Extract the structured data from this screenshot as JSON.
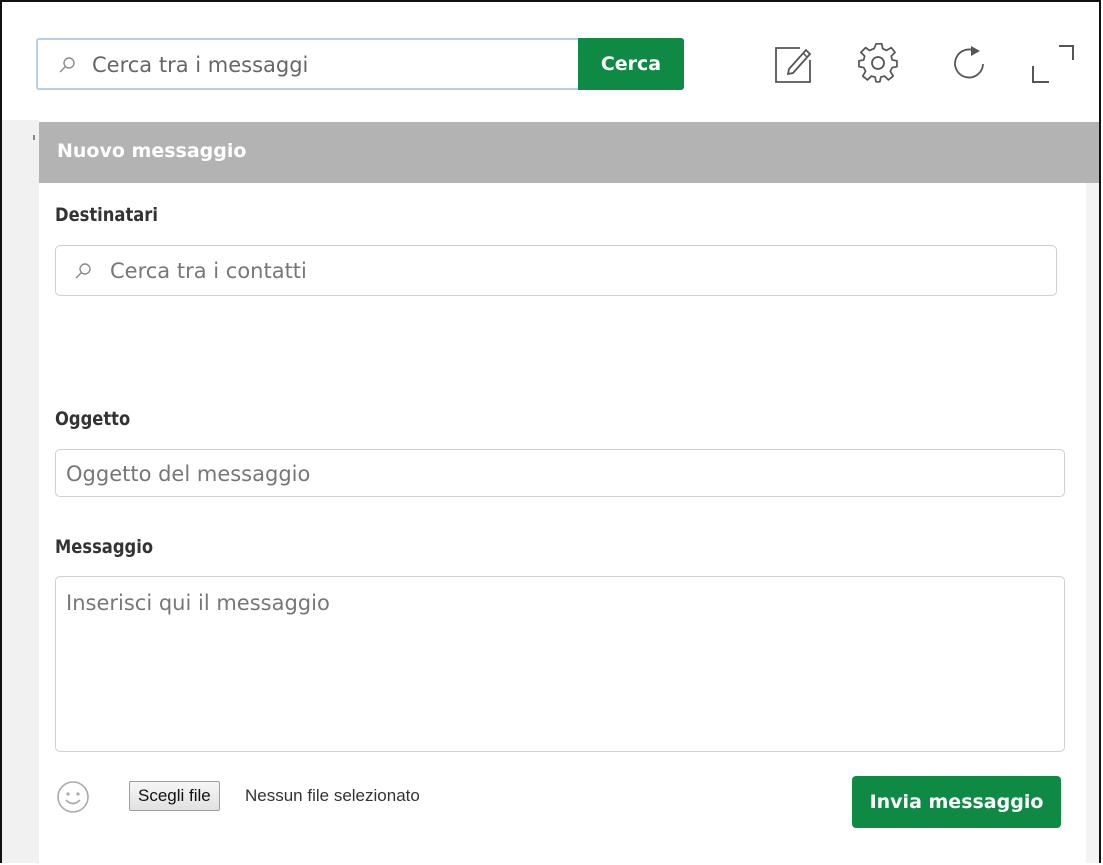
{
  "toolbar": {
    "search_placeholder": "Cerca tra i messaggi",
    "search_button_label": "Cerca",
    "icons": [
      "compose-icon",
      "gear-icon",
      "refresh-icon",
      "expand-icon"
    ]
  },
  "compose": {
    "title": "Nuovo messaggio",
    "recipients_label": "Destinatari",
    "recipients_placeholder": "Cerca tra i contatti",
    "subject_label": "Oggetto",
    "subject_placeholder": "Oggetto del messaggio",
    "message_label": "Messaggio",
    "message_placeholder": "Inserisci qui il messaggio",
    "choose_file_label": "Scegli file",
    "file_status": "Nessun file selezionato",
    "send_label": "Invia messaggio"
  },
  "colors": {
    "accent_green": "#0f8a44",
    "header_gray": "#b3b3b3",
    "search_border": "#b9cfe6"
  }
}
